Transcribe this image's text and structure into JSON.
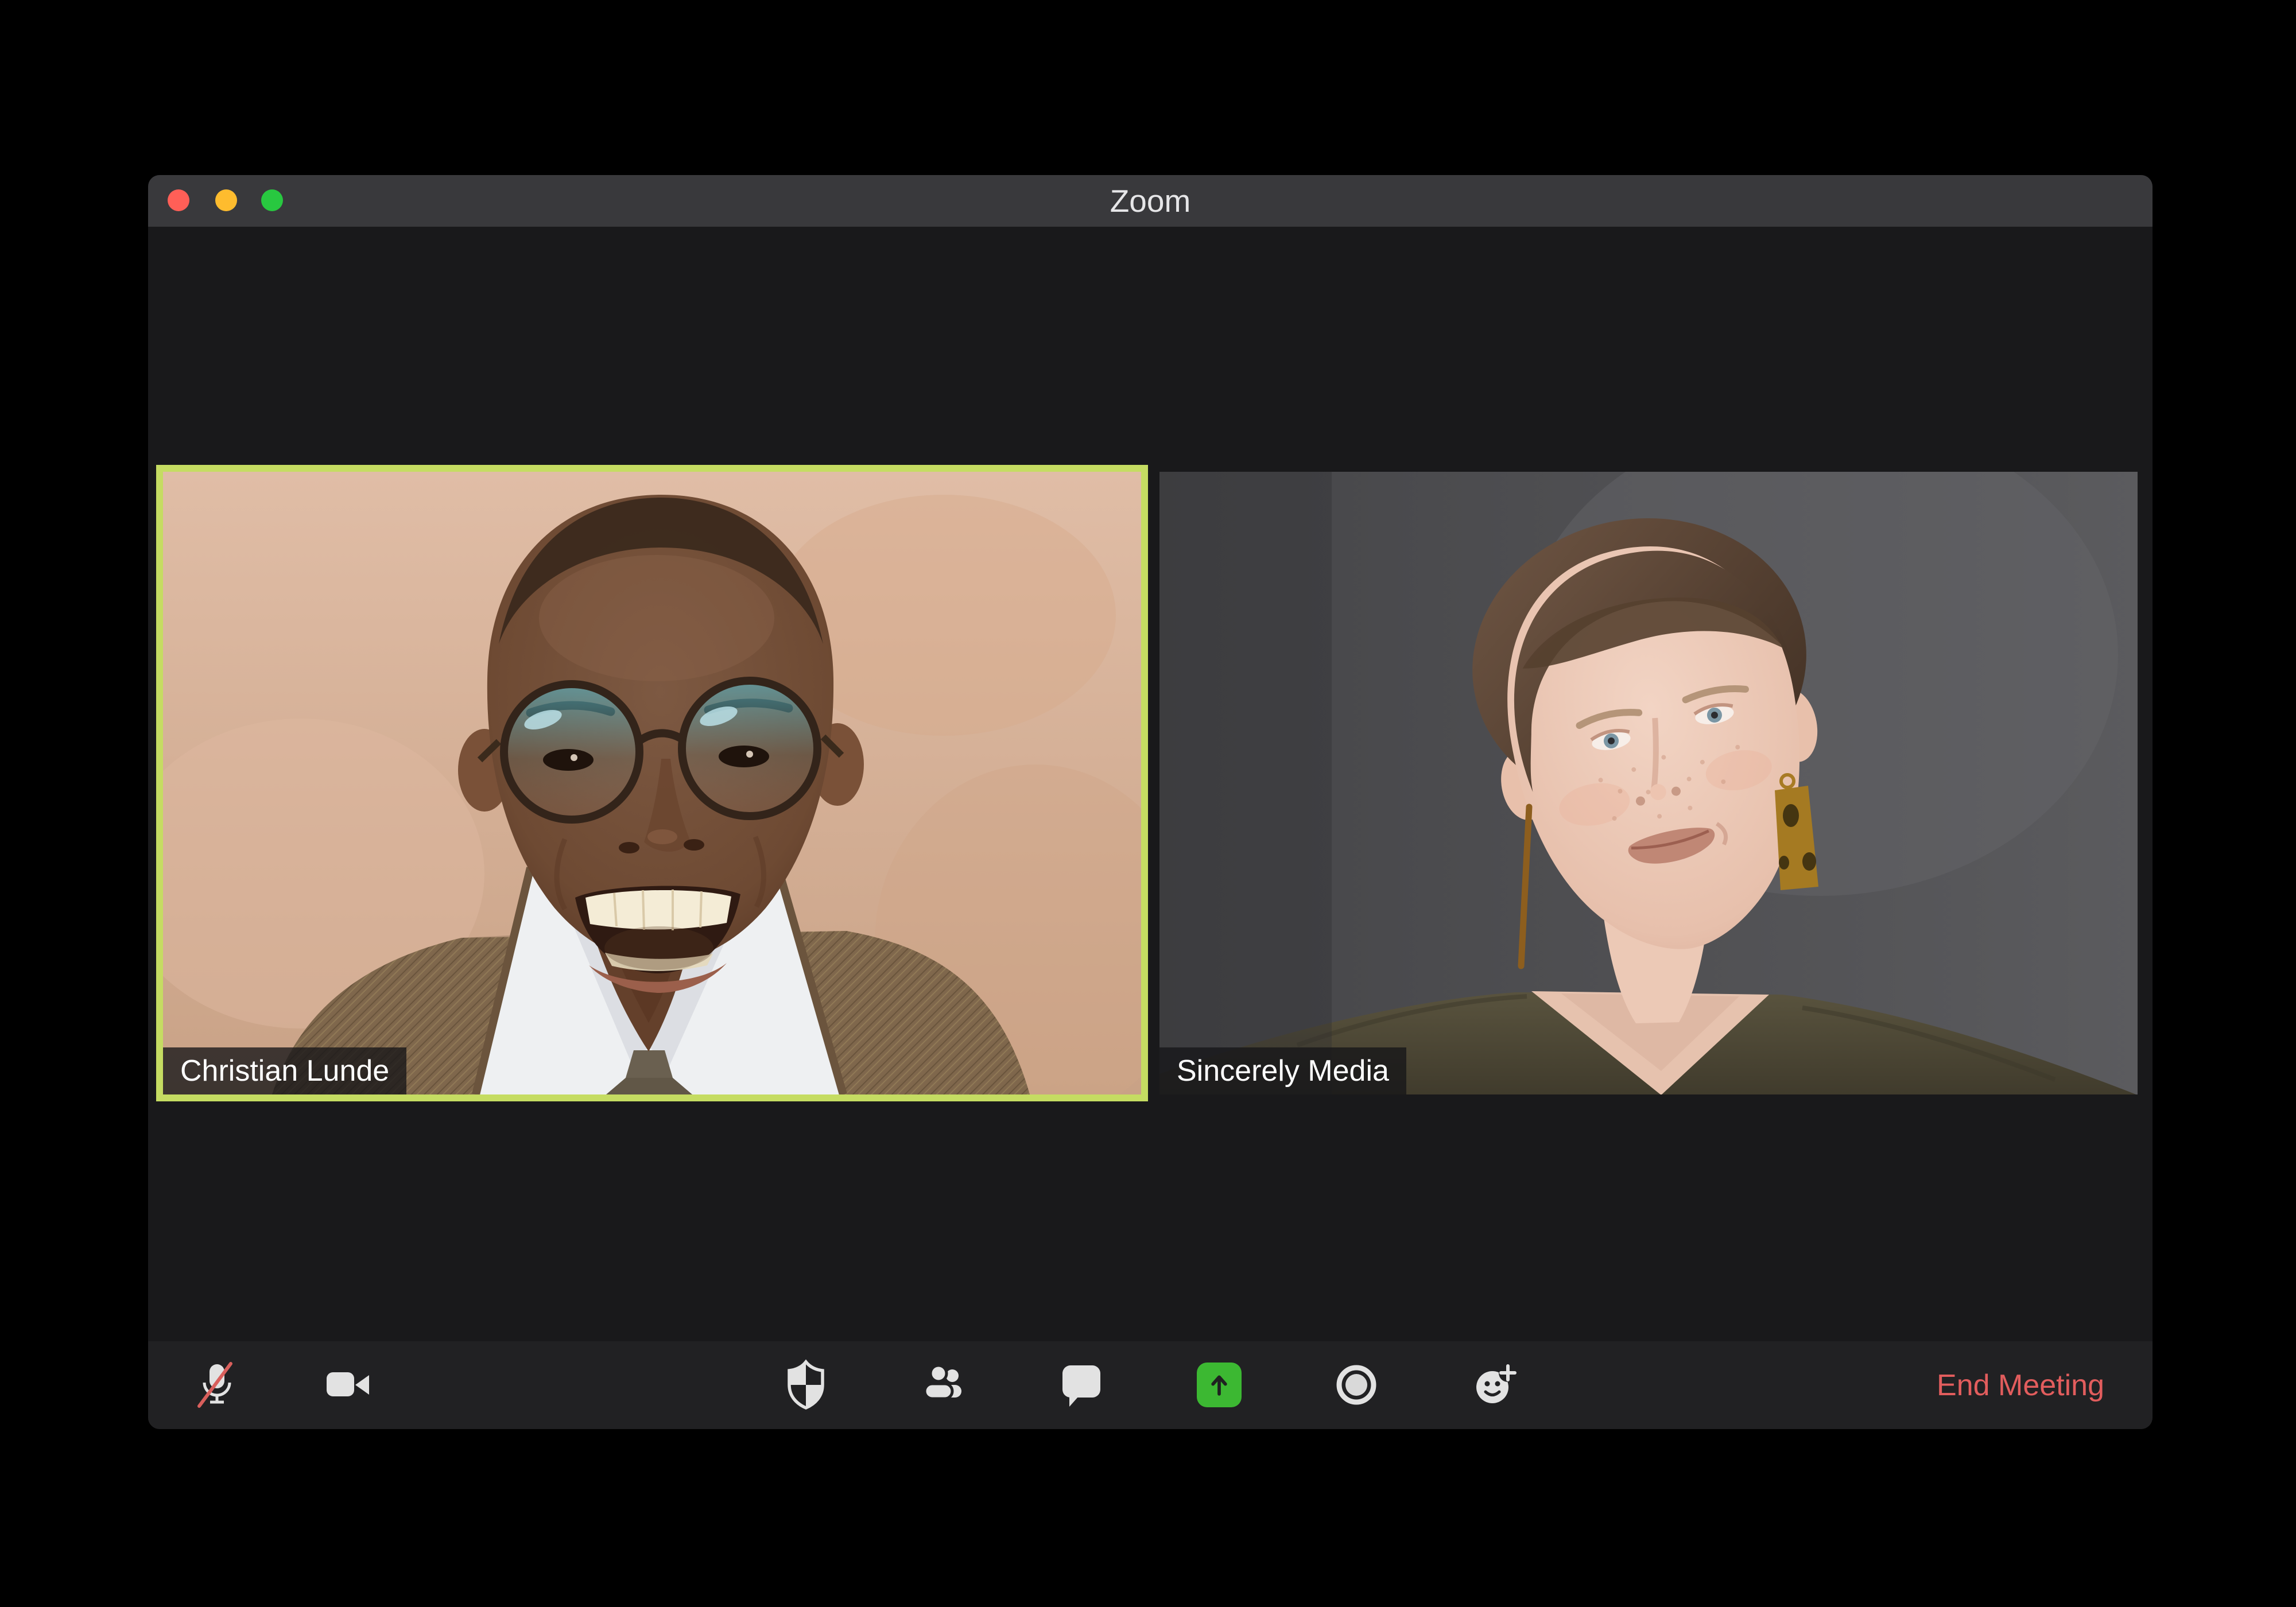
{
  "window": {
    "title": "Zoom"
  },
  "titlebar": {
    "traffic_lights": [
      {
        "name": "close",
        "color": "#ff5f57"
      },
      {
        "name": "minimize",
        "color": "#febc2e"
      },
      {
        "name": "maximize",
        "color": "#28c840"
      }
    ]
  },
  "participants": [
    {
      "name": "Christian Lunde",
      "active_speaker": true
    },
    {
      "name": "Sincerely Media",
      "active_speaker": false
    }
  ],
  "toolbar": {
    "buttons": [
      {
        "icon": "microphone-muted-icon",
        "state": "muted"
      },
      {
        "icon": "video-camera-icon"
      },
      {
        "icon": "security-shield-icon"
      },
      {
        "icon": "participants-icon"
      },
      {
        "icon": "chat-bubble-icon"
      },
      {
        "icon": "share-screen-icon"
      },
      {
        "icon": "record-icon"
      },
      {
        "icon": "reactions-icon"
      }
    ],
    "end_meeting_label": "End Meeting"
  },
  "colors": {
    "active_speaker_border": "#c5dc62",
    "end_meeting_text": "#e25d5d",
    "titlebar_bg": "#39393c",
    "window_bg": "#19191b",
    "toolbar_bg": "#212123",
    "share_button_green": "#3cb832",
    "mute_slash_red": "#d95f5c",
    "icon_gray": "#e2e2e2"
  }
}
